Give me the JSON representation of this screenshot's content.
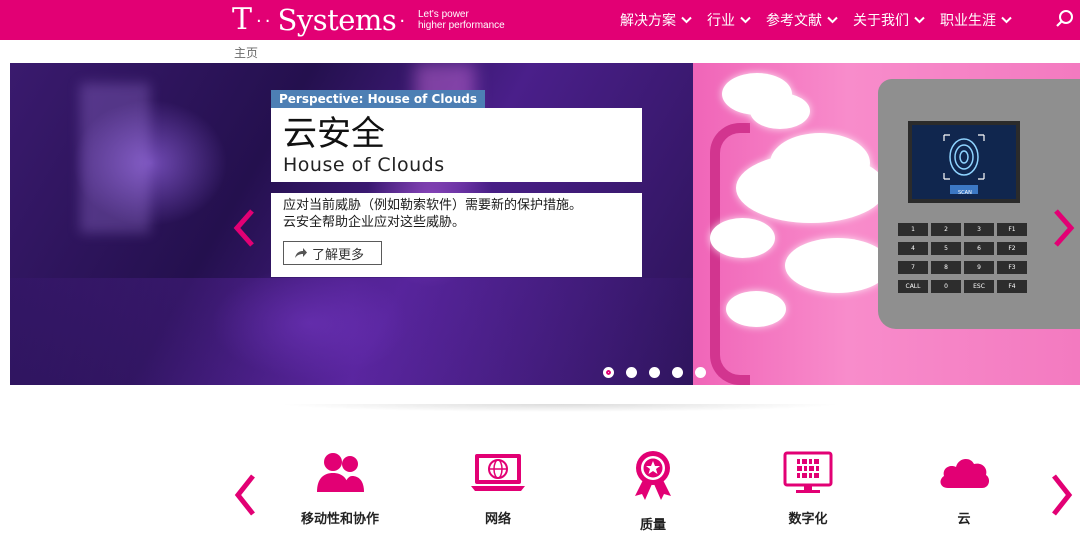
{
  "header": {
    "logo": {
      "t": "T",
      "dots": "··",
      "word": "Systems",
      "enddot": "·"
    },
    "tagline_line1": "Let's power",
    "tagline_line2": "higher performance",
    "nav": [
      {
        "label": "解决方案"
      },
      {
        "label": "行业"
      },
      {
        "label": "参考文献"
      },
      {
        "label": "关于我们"
      },
      {
        "label": "职业生涯"
      }
    ],
    "search_icon": "search-icon"
  },
  "breadcrumb": "主页",
  "hero": {
    "tag": "Perspective: House of Clouds",
    "title": "云安全",
    "subtitle": "House of Clouds",
    "description_line1": "应对当前威胁（例如勒索软件）需要新的保护措施。",
    "description_line2": "云安全帮助企业应对这些威胁。",
    "button_label": "了解更多",
    "keypad": [
      "1",
      "2",
      "3",
      "F1",
      "4",
      "5",
      "6",
      "F2",
      "7",
      "8",
      "9",
      "F3",
      "CALL",
      "0",
      "ESC",
      "F4"
    ],
    "screen_label": "SCAN",
    "slides_total": 5,
    "active_slide": 1
  },
  "categories": [
    {
      "label": "移动性和协作",
      "icon": "users-icon"
    },
    {
      "label": "网络",
      "icon": "network-globe-icon"
    },
    {
      "label": "质量",
      "icon": "quality-badge-icon"
    },
    {
      "label": "数字化",
      "icon": "binary-monitor-icon"
    },
    {
      "label": "云",
      "icon": "cloud-icon"
    }
  ],
  "colors": {
    "brand": "#e20074",
    "tag": "#4d7fb4"
  }
}
